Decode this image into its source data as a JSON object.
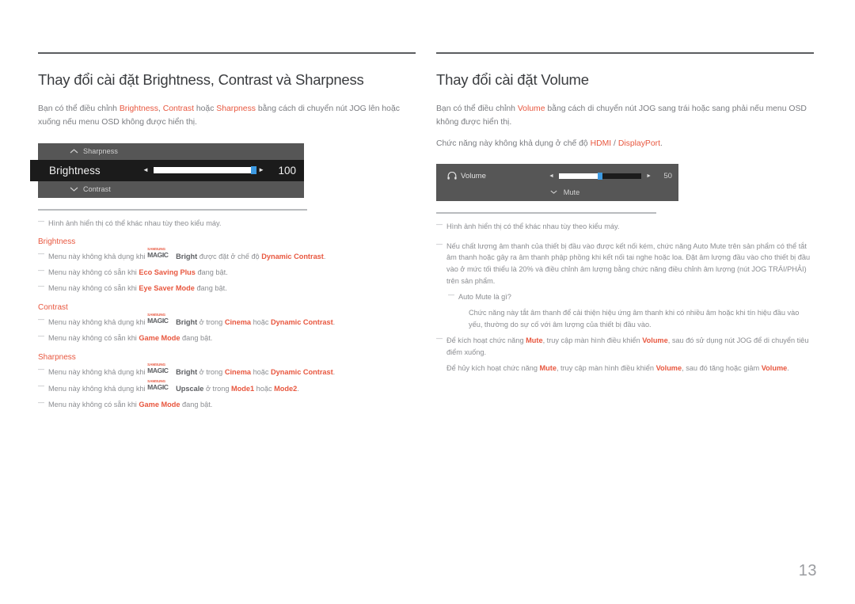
{
  "page": {
    "number": "13"
  },
  "left": {
    "title": "Thay đổi cài đặt Brightness, Contrast và Sharpness",
    "intro": {
      "p1": "Bạn có thể điều chỉnh ",
      "t1": "Brightness",
      "p2": ", ",
      "t2": "Contrast",
      "p3": " hoặc ",
      "t3": "Sharpness",
      "p4": " bằng cách di chuyển nút JOG lên hoặc xuống nếu menu OSD không được hiển thị."
    },
    "osd": {
      "top_item": "Sharpness",
      "top_caret": "caret-up-icon",
      "active_label": "Brightness",
      "active_value": "100",
      "slider_percent": 100,
      "left_arrow": "◄",
      "right_arrow": "►",
      "bottom_item": "Contrast",
      "bottom_caret": "caret-down-icon"
    },
    "note_image": "Hình ảnh hiển thị có thể khác nhau tùy theo kiểu máy.",
    "brightness": {
      "heading": "Brightness",
      "n1": {
        "a": "Menu này không khả dụng khi ",
        "logo_top": "SAMSUNG",
        "logo_bottom": "MAGIC",
        "b": "Bright",
        "c": " được đặt ở chế độ ",
        "d": "Dynamic Contrast",
        "e": "."
      },
      "n2": {
        "a": "Menu này không có sẵn khi ",
        "b": "Eco Saving Plus",
        "c": " đang bật."
      },
      "n3": {
        "a": "Menu này không có sẵn khi ",
        "b": "Eye Saver Mode",
        "c": " đang bật."
      }
    },
    "contrast": {
      "heading": "Contrast",
      "n1": {
        "a": "Menu này không khả dụng khi ",
        "logo_top": "SAMSUNG",
        "logo_bottom": "MAGIC",
        "b": "Bright",
        "c": " ở trong ",
        "d": "Cinema",
        "e": " hoặc ",
        "f": "Dynamic Contrast",
        "g": "."
      },
      "n2": {
        "a": "Menu này không có sẵn khi ",
        "b": "Game Mode",
        "c": " đang bật."
      }
    },
    "sharpness": {
      "heading": "Sharpness",
      "n1": {
        "a": "Menu này không khả dụng khi ",
        "logo_top": "SAMSUNG",
        "logo_bottom": "MAGIC",
        "b": "Bright",
        "c": " ở trong ",
        "d": "Cinema",
        "e": " hoặc ",
        "f": "Dynamic Contrast",
        "g": "."
      },
      "n2": {
        "a": "Menu này không khả dụng khi ",
        "logo_top": "SAMSUNG",
        "logo_bottom": "MAGIC",
        "b": "Upscale",
        "c": " ở trong ",
        "d": "Mode1",
        "e": " hoặc ",
        "f": "Mode2",
        "g": "."
      },
      "n3": {
        "a": "Menu này không có sẵn khi ",
        "b": "Game Mode",
        "c": " đang bật."
      }
    }
  },
  "right": {
    "title": "Thay đổi cài đặt Volume",
    "intro": {
      "p1": "Bạn có thể điều chỉnh ",
      "t1": "Volume",
      "p2": " bằng cách di chuyển nút JOG sang trái hoặc sang phải nếu menu OSD không được hiển thị."
    },
    "intro2": {
      "p1": "Chức năng này không khả dụng ở chế độ ",
      "t1": "HDMI",
      "p2": " / ",
      "t2": "DisplayPort",
      "p3": "."
    },
    "osd": {
      "icon": "headphone-icon",
      "label": "Volume",
      "value": "50",
      "slider_percent": 50,
      "left_arrow": "◄",
      "right_arrow": "►",
      "mute_label": "Mute",
      "mute_caret": "caret-down-icon"
    },
    "note_image": "Hình ảnh hiển thị có thể khác nhau tùy theo kiểu máy.",
    "note_quality": "Nếu chất lượng âm thanh của thiết bị đầu vào được kết nối kém, chức năng Auto Mute trên sản phẩm có thể tắt âm thanh hoặc gây ra âm thanh phập phồng khi kết nối tai nghe hoặc loa. Đặt âm lượng đầu vào cho thiết bị đầu vào ở mức tối thiểu là 20% và điều chỉnh âm lượng bằng chức năng điều chỉnh âm lượng (nút JOG TRÁI/PHẢI) trên sản phẩm.",
    "note_automute_q": "Auto Mute là gì?",
    "note_automute_a": "Chức năng này tắt âm thanh để cải thiện hiệu ứng âm thanh khi có nhiều âm hoặc khi tín hiệu đầu vào yếu, thường do sự cố với âm lượng của thiết bị đầu vào.",
    "note_mute_on": {
      "a": "Để kích hoạt chức năng ",
      "b": "Mute",
      "c": ", truy cập màn hình điều khiển ",
      "d": "Volume",
      "e": ", sau đó sử dụng nút JOG để di chuyển tiêu điểm xuống."
    },
    "note_mute_off": {
      "a": "Để hủy kích hoạt chức năng ",
      "b": "Mute",
      "c": ", truy cập màn hình điều khiển ",
      "d": "Volume",
      "e": ", sau đó tăng hoặc giảm ",
      "f": "Volume",
      "g": "."
    }
  },
  "colors": {
    "accent": "#e8573f",
    "heading": "#3a3c3f",
    "body": "#8b8d91",
    "osd_panel": "#565656",
    "osd_active": "#1b1b1b",
    "slider_knob": "#3d9ae2"
  }
}
